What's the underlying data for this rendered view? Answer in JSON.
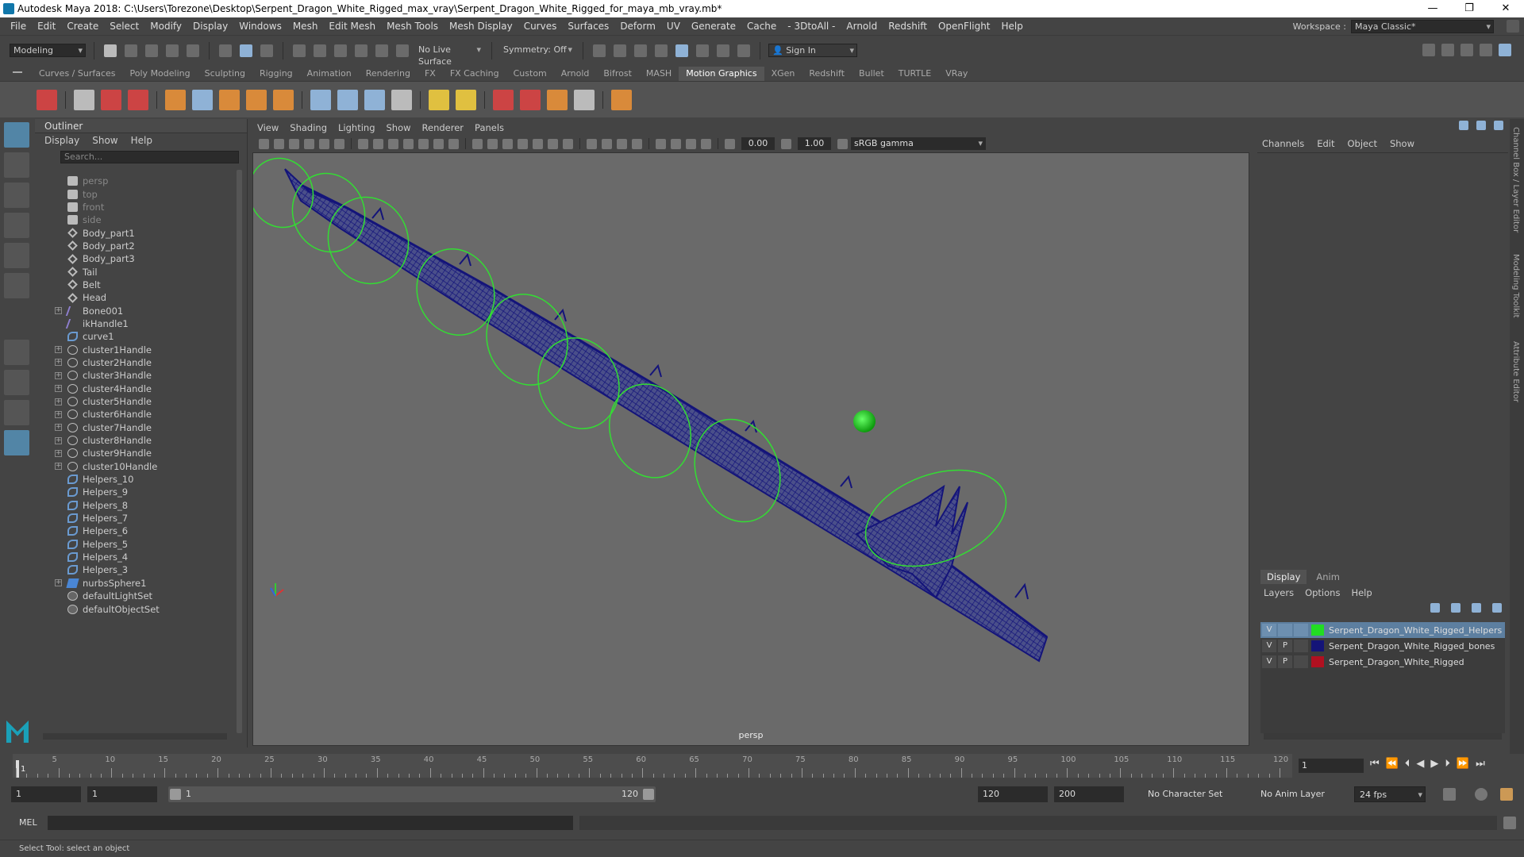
{
  "window": {
    "title": "Autodesk Maya 2018: C:\\Users\\Torezone\\Desktop\\Serpent_Dragon_White_Rigged_max_vray\\Serpent_Dragon_White_Rigged_for_maya_mb_vray.mb*",
    "minimize": "—",
    "maximize": "❐",
    "close": "✕"
  },
  "menubar": {
    "items": [
      "File",
      "Edit",
      "Create",
      "Select",
      "Modify",
      "Display",
      "Windows",
      "Mesh",
      "Edit Mesh",
      "Mesh Tools",
      "Mesh Display",
      "Curves",
      "Surfaces",
      "Deform",
      "UV",
      "Generate",
      "Cache",
      "- 3DtoAll -",
      "Arnold",
      "Redshift",
      "OpenFlight",
      "Help"
    ],
    "workspace_label": "Workspace :",
    "workspace_value": "Maya Classic*"
  },
  "statusline": {
    "mode": "Modeling",
    "live_surface": "No Live Surface",
    "symmetry": "Symmetry: Off",
    "sign_in": "Sign In"
  },
  "shelf": {
    "tabs": [
      "Curves / Surfaces",
      "Poly Modeling",
      "Sculpting",
      "Rigging",
      "Animation",
      "Rendering",
      "FX",
      "FX Caching",
      "Custom",
      "Arnold",
      "Bifrost",
      "MASH",
      "Motion Graphics",
      "XGen",
      "Redshift",
      "Bullet",
      "TURTLE",
      "VRay"
    ],
    "active_tab": "Motion Graphics"
  },
  "outliner": {
    "title": "Outliner",
    "menu": [
      "Display",
      "Show",
      "Help"
    ],
    "search_placeholder": "Search...",
    "items": [
      {
        "label": "persp",
        "icon": "camera-icon",
        "kind": "cam",
        "dim": true,
        "expandable": false
      },
      {
        "label": "top",
        "icon": "camera-icon",
        "kind": "cam",
        "dim": true,
        "expandable": false
      },
      {
        "label": "front",
        "icon": "camera-icon",
        "kind": "cam",
        "dim": true,
        "expandable": false
      },
      {
        "label": "side",
        "icon": "camera-icon",
        "kind": "cam",
        "dim": true,
        "expandable": false
      },
      {
        "label": "Body_part1",
        "icon": "mesh-icon",
        "kind": "mesh",
        "dim": false,
        "expandable": false
      },
      {
        "label": "Body_part2",
        "icon": "mesh-icon",
        "kind": "mesh",
        "dim": false,
        "expandable": false
      },
      {
        "label": "Body_part3",
        "icon": "mesh-icon",
        "kind": "mesh",
        "dim": false,
        "expandable": false
      },
      {
        "label": "Tail",
        "icon": "mesh-icon",
        "kind": "mesh",
        "dim": false,
        "expandable": false
      },
      {
        "label": "Belt",
        "icon": "mesh-icon",
        "kind": "mesh",
        "dim": false,
        "expandable": false
      },
      {
        "label": "Head",
        "icon": "mesh-icon",
        "kind": "mesh",
        "dim": false,
        "expandable": false
      },
      {
        "label": "Bone001",
        "icon": "joint-icon",
        "kind": "bone",
        "dim": false,
        "expandable": true
      },
      {
        "label": "ikHandle1",
        "icon": "ik-handle-icon",
        "kind": "bone",
        "dim": false,
        "expandable": false
      },
      {
        "label": "curve1",
        "icon": "curve-icon",
        "kind": "curve",
        "dim": false,
        "expandable": false
      },
      {
        "label": "cluster1Handle",
        "icon": "cluster-icon",
        "kind": "cluster",
        "dim": false,
        "expandable": true
      },
      {
        "label": "cluster2Handle",
        "icon": "cluster-icon",
        "kind": "cluster",
        "dim": false,
        "expandable": true
      },
      {
        "label": "cluster3Handle",
        "icon": "cluster-icon",
        "kind": "cluster",
        "dim": false,
        "expandable": true
      },
      {
        "label": "cluster4Handle",
        "icon": "cluster-icon",
        "kind": "cluster",
        "dim": false,
        "expandable": true
      },
      {
        "label": "cluster5Handle",
        "icon": "cluster-icon",
        "kind": "cluster",
        "dim": false,
        "expandable": true
      },
      {
        "label": "cluster6Handle",
        "icon": "cluster-icon",
        "kind": "cluster",
        "dim": false,
        "expandable": true
      },
      {
        "label": "cluster7Handle",
        "icon": "cluster-icon",
        "kind": "cluster",
        "dim": false,
        "expandable": true
      },
      {
        "label": "cluster8Handle",
        "icon": "cluster-icon",
        "kind": "cluster",
        "dim": false,
        "expandable": true
      },
      {
        "label": "cluster9Handle",
        "icon": "cluster-icon",
        "kind": "cluster",
        "dim": false,
        "expandable": true
      },
      {
        "label": "cluster10Handle",
        "icon": "cluster-icon",
        "kind": "cluster",
        "dim": false,
        "expandable": true
      },
      {
        "label": "Helpers_10",
        "icon": "curve-icon",
        "kind": "curve",
        "dim": false,
        "expandable": false
      },
      {
        "label": "Helpers_9",
        "icon": "curve-icon",
        "kind": "curve",
        "dim": false,
        "expandable": false
      },
      {
        "label": "Helpers_8",
        "icon": "curve-icon",
        "kind": "curve",
        "dim": false,
        "expandable": false
      },
      {
        "label": "Helpers_7",
        "icon": "curve-icon",
        "kind": "curve",
        "dim": false,
        "expandable": false
      },
      {
        "label": "Helpers_6",
        "icon": "curve-icon",
        "kind": "curve",
        "dim": false,
        "expandable": false
      },
      {
        "label": "Helpers_5",
        "icon": "curve-icon",
        "kind": "curve",
        "dim": false,
        "expandable": false
      },
      {
        "label": "Helpers_4",
        "icon": "curve-icon",
        "kind": "curve",
        "dim": false,
        "expandable": false
      },
      {
        "label": "Helpers_3",
        "icon": "curve-icon",
        "kind": "curve",
        "dim": false,
        "expandable": false
      },
      {
        "label": "nurbsSphere1",
        "icon": "nurbs-surface-icon",
        "kind": "nurbs",
        "dim": false,
        "expandable": true
      },
      {
        "label": "defaultLightSet",
        "icon": "set-icon",
        "kind": "set",
        "dim": false,
        "expandable": false
      },
      {
        "label": "defaultObjectSet",
        "icon": "set-icon",
        "kind": "set",
        "dim": false,
        "expandable": false
      }
    ]
  },
  "viewport": {
    "menu": [
      "View",
      "Shading",
      "Lighting",
      "Show",
      "Renderer",
      "Panels"
    ],
    "exposure": "0.00",
    "gamma": "1.00",
    "color_space": "sRGB gamma",
    "camera_label": "persp",
    "background": "#6a6a6a",
    "mesh_color": "#1a1a8c",
    "control_color": "#33dd33"
  },
  "channelbox": {
    "menu": [
      "Channels",
      "Edit",
      "Object",
      "Show"
    ],
    "side_tabs": [
      "Channel Box / Layer Editor",
      "Modeling Toolkit",
      "Attribute Editor"
    ]
  },
  "layer_editor": {
    "tabs": [
      "Display",
      "Anim"
    ],
    "active_tab": "Display",
    "menu": [
      "Layers",
      "Options",
      "Help"
    ],
    "layers": [
      {
        "v": "V",
        "p": "",
        "name": "Serpent_Dragon_White_Rigged_Helpers",
        "color": "#22dd22",
        "selected": true
      },
      {
        "v": "V",
        "p": "P",
        "name": "Serpent_Dragon_White_Rigged_bones",
        "color": "#141478",
        "selected": false
      },
      {
        "v": "V",
        "p": "P",
        "name": "Serpent_Dragon_White_Rigged",
        "color": "#b01020",
        "selected": false
      }
    ]
  },
  "timeline": {
    "ticks": [
      1,
      5,
      10,
      15,
      20,
      25,
      30,
      35,
      40,
      45,
      50,
      55,
      60,
      65,
      70,
      75,
      80,
      85,
      90,
      95,
      100,
      105,
      110,
      115,
      120
    ],
    "current_frame": "1",
    "playhead_frame": "1"
  },
  "range": {
    "start": "1",
    "playback_start": "1",
    "range_start_label": "1",
    "range_end_label": "120",
    "playback_end": "120",
    "end": "200",
    "character_set": "No Character Set",
    "anim_layer": "No Anim Layer",
    "fps": "24 fps"
  },
  "command": {
    "lang": "MEL"
  },
  "help_line": "Select Tool: select an object"
}
